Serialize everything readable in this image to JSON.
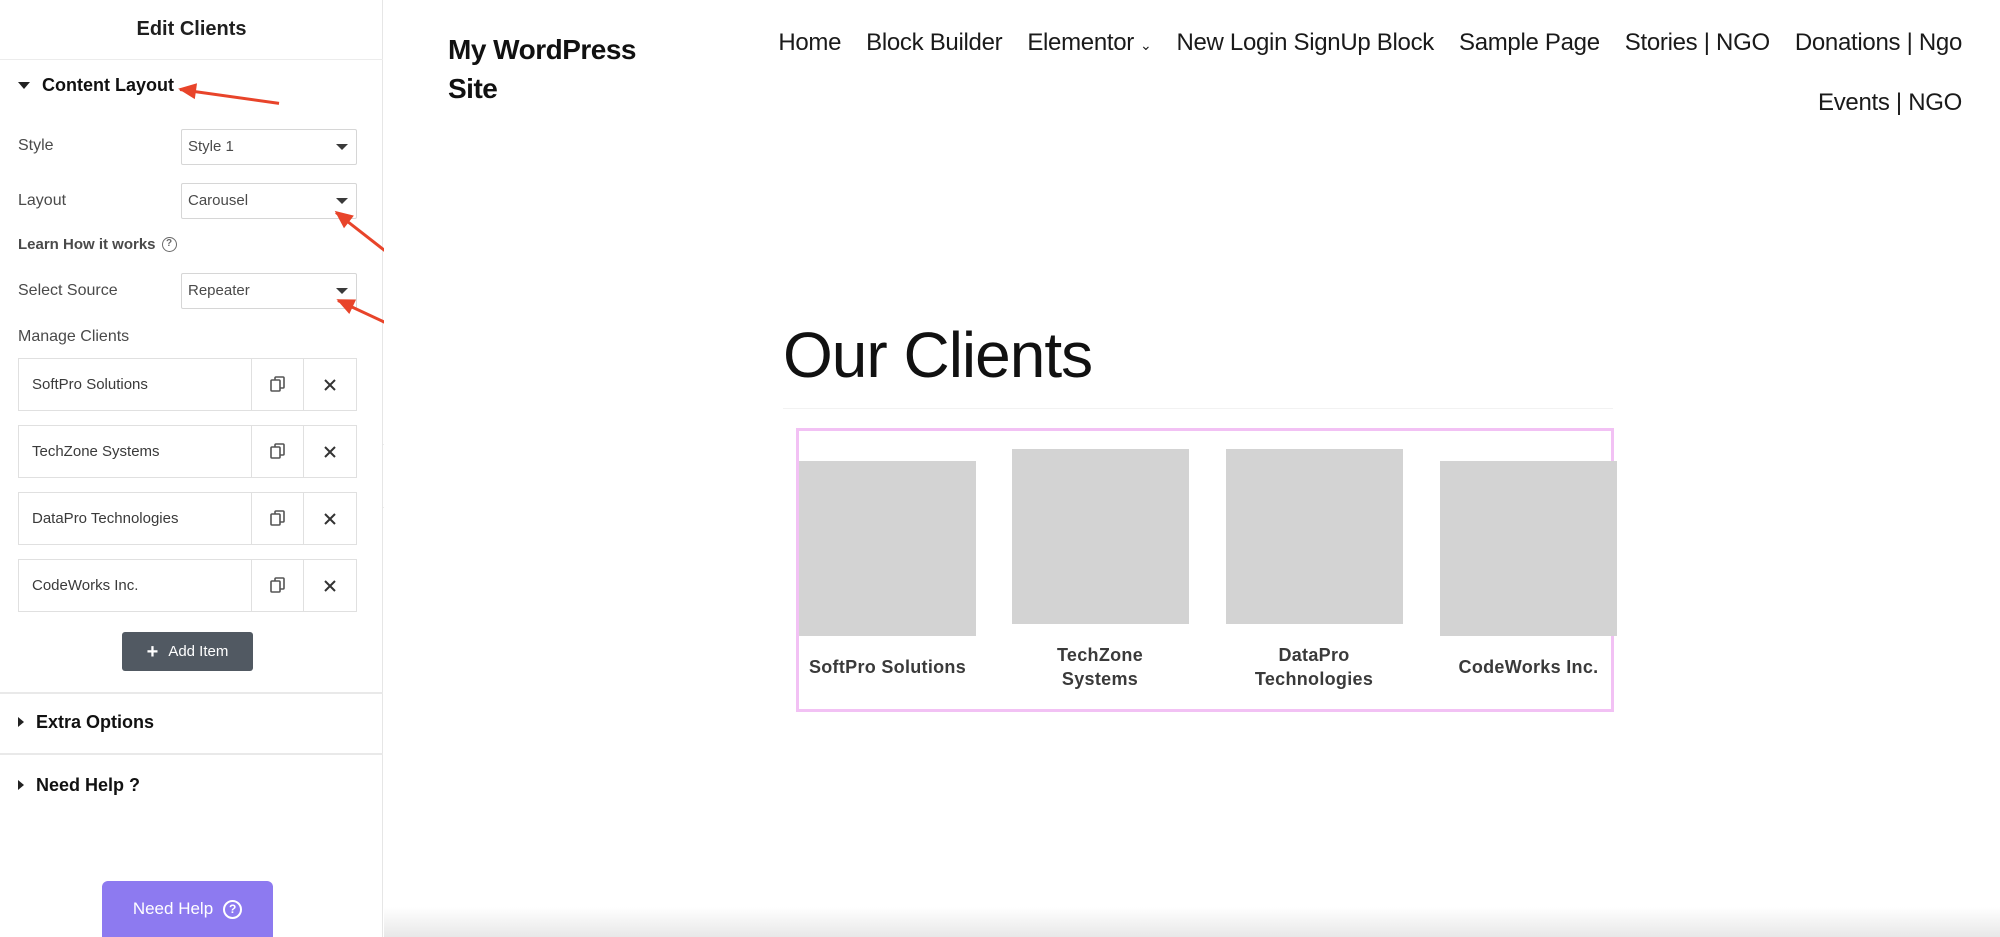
{
  "panel": {
    "title": "Edit Clients",
    "content_layout": {
      "heading": "Content Layout",
      "style_label": "Style",
      "style_value": "Style 1",
      "layout_label": "Layout",
      "layout_value": "Carousel",
      "learn_link": "Learn How it works",
      "source_label": "Select Source",
      "source_value": "Repeater",
      "manage_label": "Manage Clients",
      "items": [
        {
          "label": "SoftPro Solutions"
        },
        {
          "label": "TechZone Systems"
        },
        {
          "label": "DataPro Technologies"
        },
        {
          "label": "CodeWorks Inc."
        }
      ],
      "add_item_label": "Add Item"
    },
    "extra_options": "Extra Options",
    "need_help_section": "Need Help ?",
    "need_help_button": "Need Help",
    "annotation_color": "#e8442a"
  },
  "site": {
    "title": "My WordPress Site",
    "nav": [
      {
        "label": "Home"
      },
      {
        "label": "Block Builder"
      },
      {
        "label": "Elementor"
      },
      {
        "label": "New Login SignUp Block"
      },
      {
        "label": "Sample Page"
      },
      {
        "label": "Stories | NGO"
      },
      {
        "label": "Donations | Ngo"
      },
      {
        "label": "Events | NGO"
      }
    ],
    "heading": "Our Clients",
    "clients": [
      {
        "name": "SoftPro Solutions"
      },
      {
        "name": "TechZone Systems"
      },
      {
        "name": "DataPro Technologies"
      },
      {
        "name": "CodeWorks Inc."
      }
    ],
    "carousel_border_color": "#f2c1f4",
    "placeholder_color": "#d3d3d3"
  }
}
